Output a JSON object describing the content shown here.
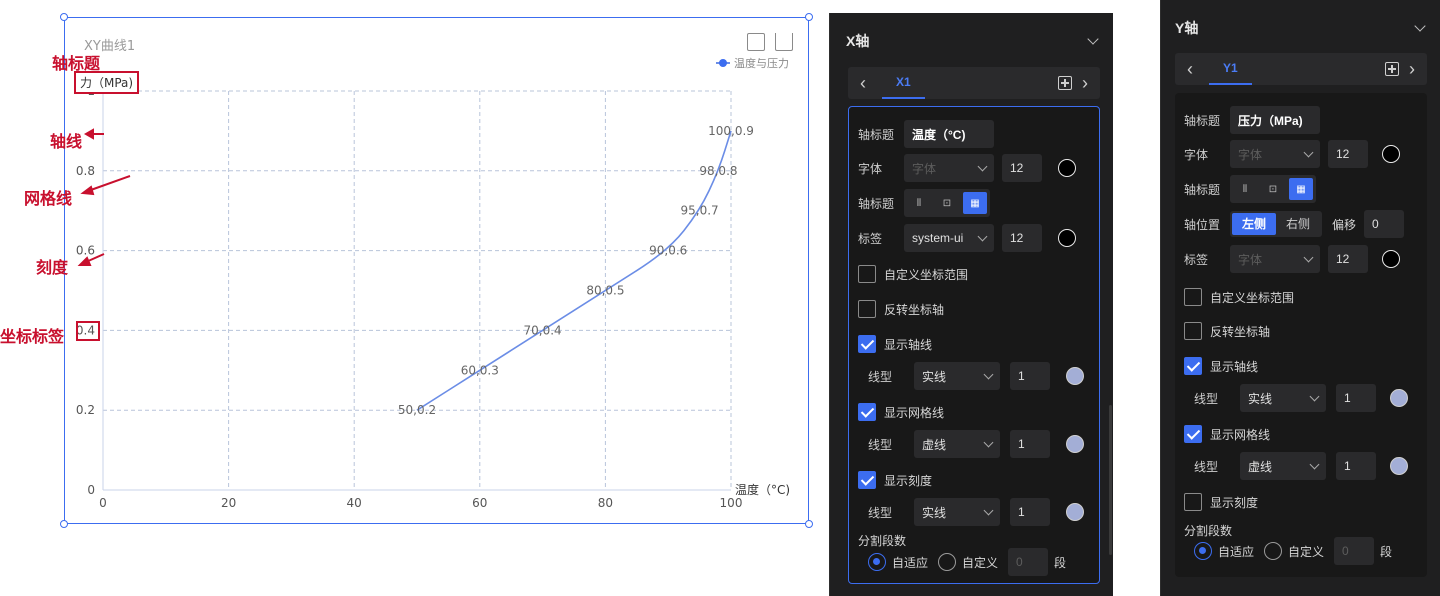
{
  "chart": {
    "title": "XY曲线1",
    "legend_label": "温度与压力",
    "y_axis_title": "力（MPa)",
    "x_axis_title": "温度（°C)",
    "line_color": "#6b8de6",
    "icons": [
      "export-icon",
      "share-icon"
    ]
  },
  "chart_data": {
    "type": "line",
    "title": "XY曲线1",
    "xlabel": "温度（°C)",
    "ylabel": "力（MPa)",
    "xlim": [
      0,
      100
    ],
    "ylim": [
      0,
      1
    ],
    "x_ticks": [
      0,
      20,
      40,
      60,
      80,
      100
    ],
    "y_ticks": [
      0,
      0.2,
      0.4,
      0.6,
      0.8,
      1
    ],
    "grid": true,
    "legend": "top-right",
    "series": [
      {
        "name": "温度与压力",
        "x": [
          50,
          60,
          70,
          80,
          90,
          95,
          98,
          100
        ],
        "y": [
          0.2,
          0.3,
          0.4,
          0.5,
          0.6,
          0.7,
          0.8,
          0.9
        ],
        "labels": [
          "50,0.2",
          "60,0.3",
          "70,0.4",
          "80,0.5",
          "90,0.6",
          "95,0.7",
          "98,0.8",
          "100,0.9"
        ]
      }
    ]
  },
  "annotations": {
    "axis_title": "轴标题",
    "axis_line": "轴线",
    "grid_line": "网格线",
    "tick": "刻度",
    "coord_label": "坐标标签"
  },
  "x_panel": {
    "title": "X轴",
    "tab": "X1",
    "axis_title_label": "轴标题",
    "axis_title_value": "温度（°C)",
    "font_label": "字体",
    "font_placeholder": "字体",
    "font_size": "12",
    "axis_title_pos_label": "轴标题",
    "tag_label": "标签",
    "tag_font": "system-ui",
    "tag_size": "12",
    "custom_range": "自定义坐标范围",
    "reverse_axis": "反转坐标轴",
    "show_axis_line": "显示轴线",
    "line_type_label": "线型",
    "axis_line_type": "实线",
    "axis_line_width": "1",
    "show_grid_line": "显示网格线",
    "grid_line_type": "虚线",
    "grid_line_width": "1",
    "show_tick": "显示刻度",
    "tick_line_type": "实线",
    "tick_line_width": "1",
    "split_label": "分割段数",
    "auto": "自适应",
    "custom": "自定义",
    "custom_value": "0",
    "unit": "段"
  },
  "y_panel": {
    "title": "Y轴",
    "tab": "Y1",
    "axis_title_label": "轴标题",
    "axis_title_value": "压力（MPa)",
    "font_label": "字体",
    "font_placeholder": "字体",
    "font_size": "12",
    "axis_title_pos_label": "轴标题",
    "pos_label": "轴位置",
    "pos_left": "左侧",
    "pos_right": "右侧",
    "offset_label": "偏移",
    "offset_value": "0",
    "tag_label": "标签",
    "tag_font": "字体",
    "tag_size": "12",
    "custom_range": "自定义坐标范围",
    "reverse_axis": "反转坐标轴",
    "show_axis_line": "显示轴线",
    "line_type_label": "线型",
    "axis_line_type": "实线",
    "axis_line_width": "1",
    "show_grid_line": "显示网格线",
    "grid_line_type": "虚线",
    "grid_line_width": "1",
    "show_tick": "显示刻度",
    "split_label": "分割段数",
    "auto": "自适应",
    "custom": "自定义",
    "custom_value": "0",
    "unit": "段"
  }
}
